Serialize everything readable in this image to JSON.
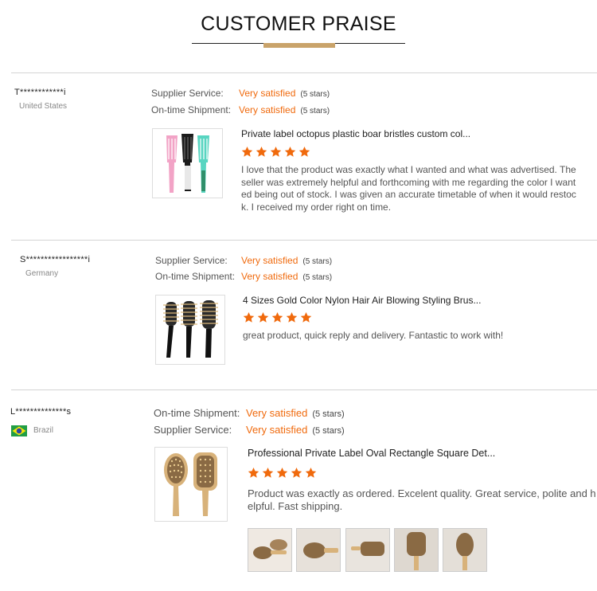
{
  "page": {
    "title": "CUSTOMER PRAISE"
  },
  "colors": {
    "accent": "#f06a0d",
    "gold": "#c9a36a",
    "separator": "#d4d4d4"
  },
  "reviews": [
    {
      "reviewer": "T************i",
      "country": "United States",
      "ratings": [
        {
          "label": "Supplier Service:",
          "value": "Very satisfied",
          "stars": "(5 stars)"
        },
        {
          "label": "On-time Shipment:",
          "value": "Very satisfied",
          "stars": "(5 stars)"
        }
      ],
      "product_title": "Private label octopus plastic boar bristles custom col...",
      "star_rating": 5,
      "comment": "I love that the product was exactly what I wanted and what was advertised. The seller was extremely helpful and forthcoming with me regarding the color I wanted being out of stock. I was given an accurate timetable of when it would restock. I received my order right on time.",
      "product_icon": "detangling-brush-image"
    },
    {
      "reviewer": "S*****************i",
      "country": "Germany",
      "ratings": [
        {
          "label": "Supplier Service:",
          "value": "Very satisfied",
          "stars": "(5 stars)"
        },
        {
          "label": "On-time Shipment:",
          "value": "Very satisfied",
          "stars": "(5 stars)"
        }
      ],
      "product_title": "4 Sizes Gold Color Nylon Hair Air Blowing Styling Brus...",
      "star_rating": 5,
      "comment": "great product, quick reply and delivery. Fantastic to work with!",
      "product_icon": "round-brush-image"
    },
    {
      "reviewer": "L**************s",
      "country": "Brazil",
      "flag_icon": "brazil-flag-icon",
      "ratings": [
        {
          "label": "On-time Shipment:",
          "value": "Very satisfied",
          "stars": "(5 stars)"
        },
        {
          "label": "Supplier Service:",
          "value": "Very satisfied",
          "stars": "(5 stars)"
        }
      ],
      "product_title": "Professional Private Label Oval Rectangle Square Det...",
      "star_rating": 5,
      "comment": "Product was exactly as ordered. Excelent quality. Great service, polite and helpful. Fast shipping.",
      "product_icon": "bamboo-brush-image",
      "photo_count": 5
    }
  ]
}
